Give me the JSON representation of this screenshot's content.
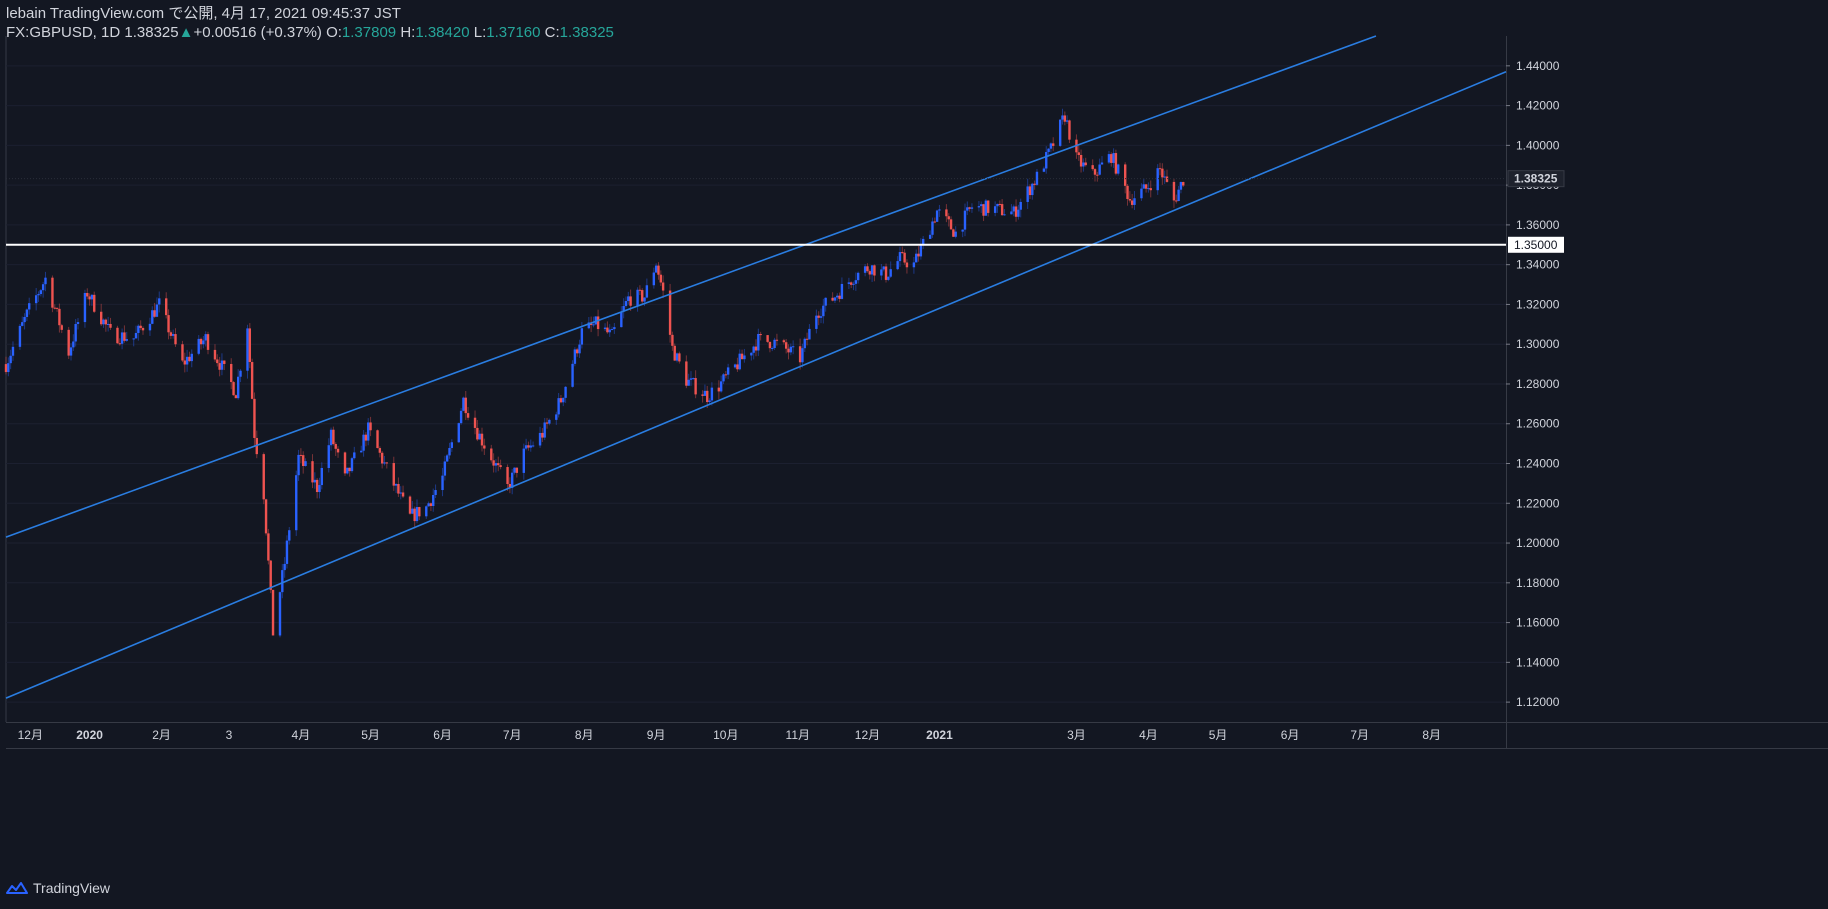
{
  "header": {
    "line1": "lebain TradingView.com で公開, 4月 17, 2021 09:45:37 JST",
    "symbol": "FX:GBPUSD, 1D",
    "last": "1.38325",
    "change_arrow": "▲",
    "change": "+0.00516 (+0.37%)",
    "o_label": "O:",
    "o_value": "1.37809",
    "h_label": "H:",
    "h_value": "1.38420",
    "l_label": "L:",
    "l_value": "1.37160",
    "c_label": "C:",
    "c_value": "1.38325"
  },
  "footer": {
    "brand": "TradingView",
    "logo_icon": "tradingview-logo-icon"
  },
  "colors": {
    "background": "#131722",
    "up": "#2962ff",
    "down": "#ef5350",
    "channel": "#2a7de1",
    "level": "#ffffff",
    "text": "#d1d4dc",
    "ohlc_value": "#26a69a"
  },
  "chart_data": {
    "type": "candlestick",
    "symbol": "FX:GBPUSD",
    "interval": "1D",
    "ylim": [
      1.11,
      1.455
    ],
    "y_ticks": [
      1.12,
      1.14,
      1.16,
      1.18,
      1.2,
      1.22,
      1.24,
      1.26,
      1.28,
      1.3,
      1.32,
      1.34,
      1.36,
      1.38,
      1.4,
      1.42,
      1.44
    ],
    "x_range": [
      "2019-11-26",
      "2021-09-02"
    ],
    "x_ticks": [
      {
        "label": "12月",
        "date": "2019-12-01",
        "bold": false
      },
      {
        "label": "2020",
        "date": "2020-01-01",
        "bold": true
      },
      {
        "label": "2月",
        "date": "2020-02-01",
        "bold": false
      },
      {
        "label": "3",
        "date": "2020-03-01",
        "bold": false
      },
      {
        "label": "4月",
        "date": "2020-04-01",
        "bold": false
      },
      {
        "label": "5月",
        "date": "2020-05-01",
        "bold": false
      },
      {
        "label": "6月",
        "date": "2020-06-01",
        "bold": false
      },
      {
        "label": "7月",
        "date": "2020-07-01",
        "bold": false
      },
      {
        "label": "8月",
        "date": "2020-08-01",
        "bold": false
      },
      {
        "label": "9月",
        "date": "2020-09-01",
        "bold": false
      },
      {
        "label": "10月",
        "date": "2020-10-01",
        "bold": false
      },
      {
        "label": "11月",
        "date": "2020-11-01",
        "bold": false
      },
      {
        "label": "12月",
        "date": "2020-12-01",
        "bold": false
      },
      {
        "label": "2021",
        "date": "2021-01-01",
        "bold": true
      },
      {
        "label": "3月",
        "date": "2021-03-01",
        "bold": false
      },
      {
        "label": "4月",
        "date": "2021-04-01",
        "bold": false
      },
      {
        "label": "5月",
        "date": "2021-05-01",
        "bold": false
      },
      {
        "label": "6月",
        "date": "2021-06-01",
        "bold": false
      },
      {
        "label": "7月",
        "date": "2021-07-01",
        "bold": false
      },
      {
        "label": "8月",
        "date": "2021-08-01",
        "bold": false
      }
    ],
    "last_price": 1.38325,
    "last_price_label": "1.38325",
    "horizontal_level": 1.35,
    "horizontal_level_label": "1.35000",
    "channel_lines": [
      {
        "name": "upper",
        "from": [
          "2019-11-26",
          1.203
        ],
        "to": [
          "2021-07-08",
          1.455
        ]
      },
      {
        "name": "lower",
        "from": [
          "2019-11-26",
          1.122
        ],
        "to": [
          "2021-09-02",
          1.437
        ]
      }
    ],
    "path": [
      [
        "2019-11-26",
        1.29
      ],
      [
        "2019-12-05",
        1.315
      ],
      [
        "2019-12-13",
        1.333
      ],
      [
        "2019-12-23",
        1.296
      ],
      [
        "2019-12-31",
        1.326
      ],
      [
        "2020-01-10",
        1.305
      ],
      [
        "2020-01-20",
        1.303
      ],
      [
        "2020-01-31",
        1.32
      ],
      [
        "2020-02-10",
        1.29
      ],
      [
        "2020-02-20",
        1.303
      ],
      [
        "2020-03-04",
        1.276
      ],
      [
        "2020-03-09",
        1.31
      ],
      [
        "2020-03-12",
        1.255
      ],
      [
        "2020-03-16",
        1.225
      ],
      [
        "2020-03-20",
        1.155
      ],
      [
        "2020-03-25",
        1.19
      ],
      [
        "2020-03-31",
        1.243
      ],
      [
        "2020-04-08",
        1.228
      ],
      [
        "2020-04-14",
        1.254
      ],
      [
        "2020-04-20",
        1.232
      ],
      [
        "2020-04-30",
        1.257
      ],
      [
        "2020-05-10",
        1.232
      ],
      [
        "2020-05-18",
        1.213
      ],
      [
        "2020-05-25",
        1.218
      ],
      [
        "2020-06-01",
        1.233
      ],
      [
        "2020-06-10",
        1.272
      ],
      [
        "2020-06-16",
        1.256
      ],
      [
        "2020-06-29",
        1.228
      ],
      [
        "2020-07-06",
        1.245
      ],
      [
        "2020-07-14",
        1.255
      ],
      [
        "2020-07-22",
        1.272
      ],
      [
        "2020-07-31",
        1.306
      ],
      [
        "2020-08-06",
        1.31
      ],
      [
        "2020-08-13",
        1.304
      ],
      [
        "2020-08-20",
        1.323
      ],
      [
        "2020-08-27",
        1.324
      ],
      [
        "2020-09-01",
        1.341
      ],
      [
        "2020-09-04",
        1.326
      ],
      [
        "2020-09-08",
        1.298
      ],
      [
        "2020-09-14",
        1.282
      ],
      [
        "2020-09-23",
        1.274
      ],
      [
        "2020-09-28",
        1.279
      ],
      [
        "2020-10-09",
        1.294
      ],
      [
        "2020-10-15",
        1.302
      ],
      [
        "2020-10-22",
        1.301
      ],
      [
        "2020-11-02",
        1.293
      ],
      [
        "2020-11-09",
        1.316
      ],
      [
        "2020-11-16",
        1.323
      ],
      [
        "2020-11-25",
        1.334
      ],
      [
        "2020-12-02",
        1.339
      ],
      [
        "2020-12-09",
        1.335
      ],
      [
        "2020-12-15",
        1.343
      ],
      [
        "2020-12-21",
        1.34
      ],
      [
        "2020-12-31",
        1.367
      ],
      [
        "2021-01-08",
        1.356
      ],
      [
        "2021-01-15",
        1.369
      ],
      [
        "2021-01-25",
        1.368
      ],
      [
        "2021-02-02",
        1.366
      ],
      [
        "2021-02-12",
        1.384
      ],
      [
        "2021-02-18",
        1.398
      ],
      [
        "2021-02-24",
        1.415
      ],
      [
        "2021-03-01",
        1.393
      ],
      [
        "2021-03-08",
        1.385
      ],
      [
        "2021-03-16",
        1.395
      ],
      [
        "2021-03-24",
        1.373
      ],
      [
        "2021-03-31",
        1.378
      ],
      [
        "2021-04-06",
        1.388
      ],
      [
        "2021-04-12",
        1.372
      ],
      [
        "2021-04-16",
        1.383
      ]
    ]
  }
}
